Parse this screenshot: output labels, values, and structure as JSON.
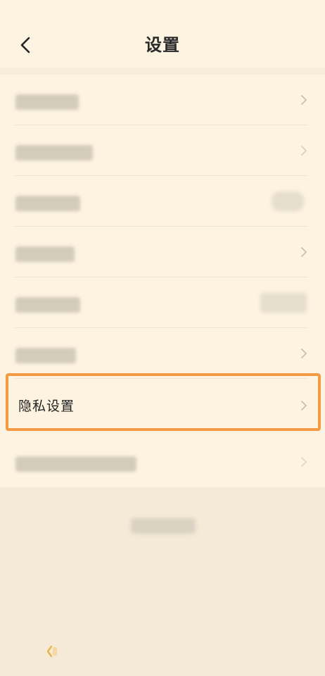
{
  "header": {
    "title": "设置"
  },
  "settings": {
    "privacy_label": "隐私设置"
  },
  "colors": {
    "highlight_border": "#f39a45",
    "background": "#fdf3e1",
    "text": "#222222"
  },
  "icons": {
    "back": "chevron-left-icon",
    "row_arrow": "chevron-right-icon"
  }
}
